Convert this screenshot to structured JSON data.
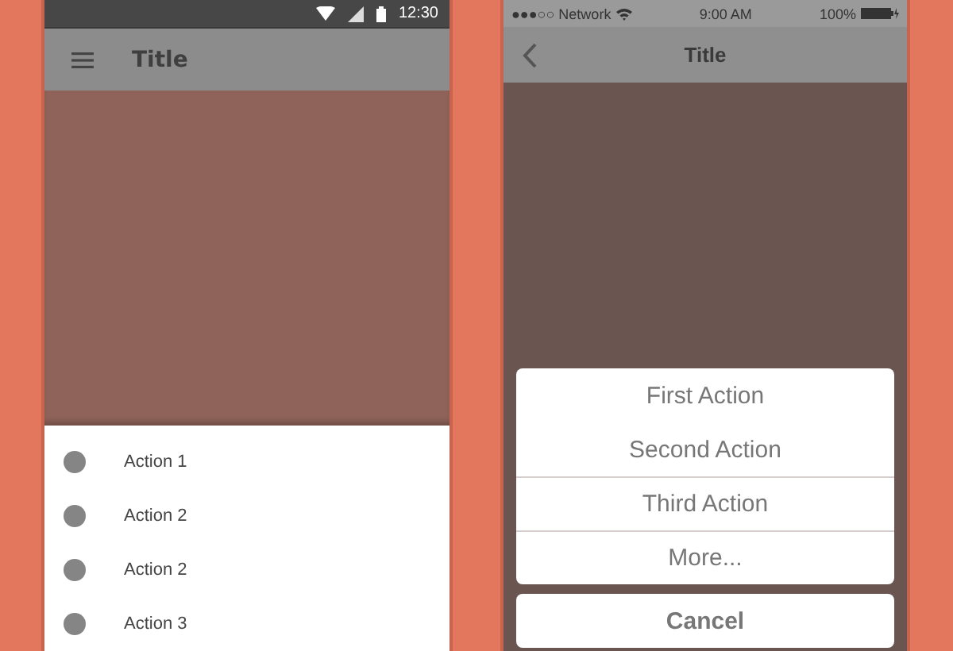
{
  "android": {
    "status_bar": {
      "time": "12:30"
    },
    "app_bar": {
      "title": "Title"
    },
    "bottom_sheet": {
      "items": [
        {
          "label": "Action 1"
        },
        {
          "label": "Action 2"
        },
        {
          "label": "Action 2"
        },
        {
          "label": "Action 3"
        }
      ]
    }
  },
  "ios": {
    "status_bar": {
      "carrier": "●●●○○ Network",
      "time": "9:00 AM",
      "battery": "100%"
    },
    "nav_bar": {
      "title": "Title"
    },
    "action_sheet": {
      "actions": [
        "First Action",
        "Second Action",
        "Third Action",
        "More..."
      ],
      "cancel": "Cancel"
    }
  }
}
